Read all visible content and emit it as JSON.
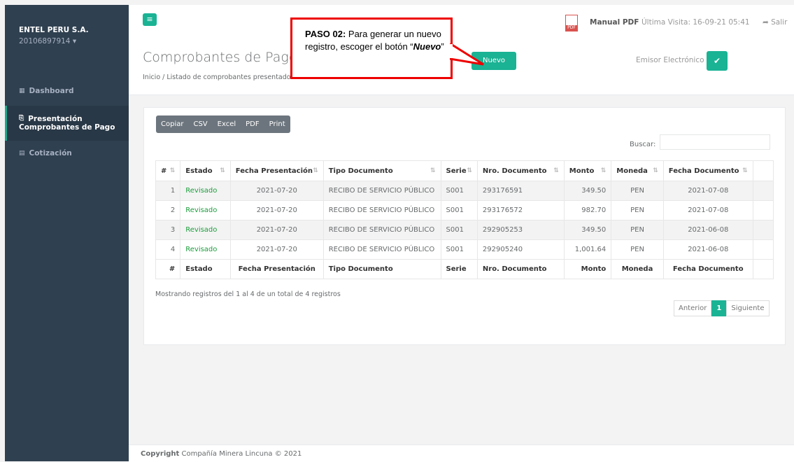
{
  "sidebar": {
    "company": "ENTEL PERU S.A.",
    "ruc": "20106897914 ▾",
    "items": [
      {
        "icon": "▦",
        "label": "Dashboard"
      },
      {
        "icon": "⎘",
        "label1": "Presentación",
        "label2": "Comprobantes de Pago"
      },
      {
        "icon": "▤",
        "label": "Cotización"
      }
    ]
  },
  "topbar": {
    "menu_icon": "≡",
    "pdf_icon": "PDF",
    "manual": "Manual PDF",
    "visit": "Última Visita: 16-09-21 05:41",
    "salir": "➦ Salir"
  },
  "heading": {
    "title": "Comprobantes de Pago",
    "breadcrumb": "Inicio / Listado de comprobantes presentados",
    "nuevo": "Nuevo",
    "emisor": "Emisor Electrónico",
    "emisor_icon": "✔"
  },
  "callout": {
    "bold": "PASO 02:",
    "text": " Para generar un nuevo registro, escoger el botón “",
    "italic": "Nuevo",
    "end": "”"
  },
  "exports": [
    "Copiar",
    "CSV",
    "Excel",
    "PDF",
    "Print"
  ],
  "search_label": "Buscar:",
  "table": {
    "headers": [
      "#",
      "Estado",
      "Fecha Presentación",
      "Tipo Documento",
      "Serie",
      "Nro. Documento",
      "Monto",
      "Moneda",
      "Fecha Documento"
    ],
    "rows": [
      [
        "1",
        "Revisado",
        "2021-07-20",
        "RECIBO DE SERVICIO PÚBLICO",
        "S001",
        "293176591",
        "349.50",
        "PEN",
        "2021-07-08"
      ],
      [
        "2",
        "Revisado",
        "2021-07-20",
        "RECIBO DE SERVICIO PÚBLICO",
        "S001",
        "293176572",
        "982.70",
        "PEN",
        "2021-07-08"
      ],
      [
        "3",
        "Revisado",
        "2021-07-20",
        "RECIBO DE SERVICIO PÚBLICO",
        "S001",
        "292905253",
        "349.50",
        "PEN",
        "2021-06-08"
      ],
      [
        "4",
        "Revisado",
        "2021-07-20",
        "RECIBO DE SERVICIO PÚBLICO",
        "S001",
        "292905240",
        "1,001.64",
        "PEN",
        "2021-06-08"
      ]
    ]
  },
  "info": "Mostrando registros del 1 al 4 de un total de 4 registros",
  "pager": {
    "prev": "Anterior",
    "current": "1",
    "next": "Siguiente"
  },
  "footer": {
    "bold": "Copyright",
    "text": " Compañía Minera Lincuna © 2021"
  }
}
